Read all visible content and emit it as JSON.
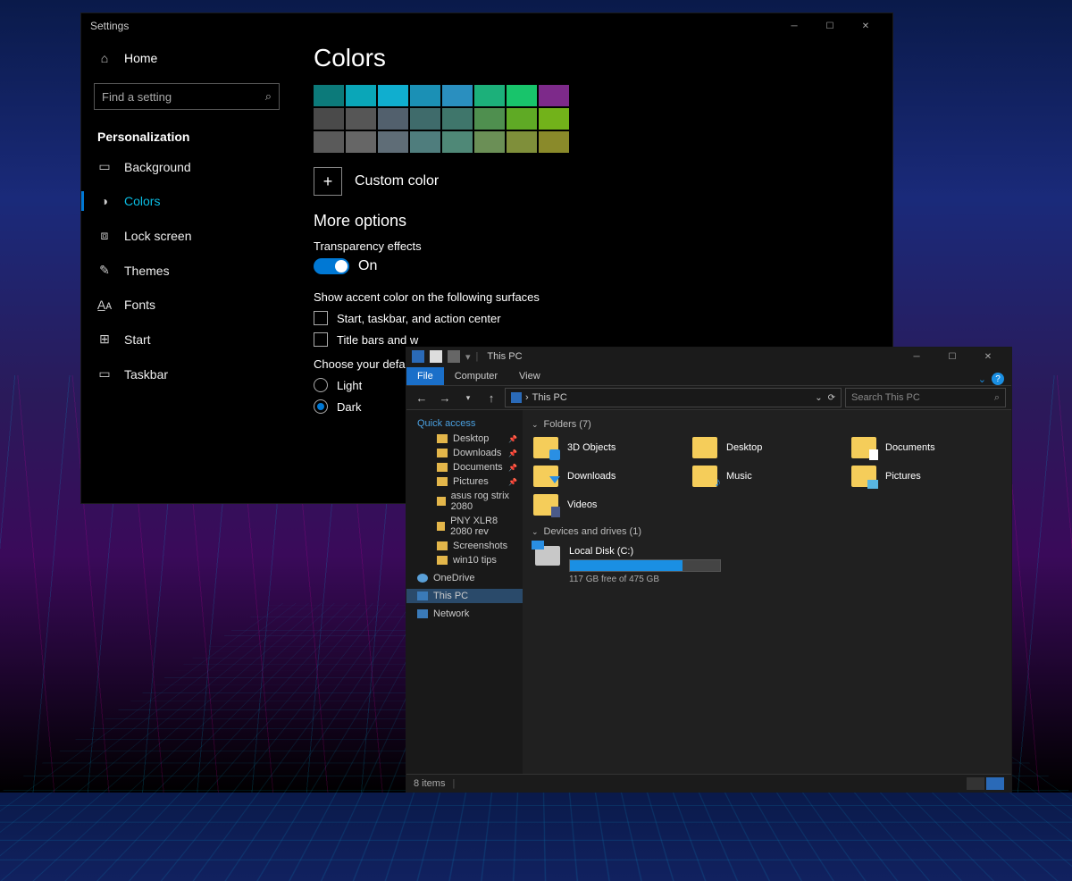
{
  "settings": {
    "window_title": "Settings",
    "home_label": "Home",
    "search_placeholder": "Find a setting",
    "section": "Personalization",
    "nav": [
      {
        "icon": "▭",
        "label": "Background"
      },
      {
        "icon": "◑",
        "label": "Colors",
        "active": true
      },
      {
        "icon": "⧈",
        "label": "Lock screen"
      },
      {
        "icon": "✎",
        "label": "Themes"
      },
      {
        "icon": "A̲ᴀ",
        "label": "Fonts"
      },
      {
        "icon": "⊞",
        "label": "Start"
      },
      {
        "icon": "▭",
        "label": "Taskbar"
      }
    ],
    "page_title": "Colors",
    "swatches_row1": [
      "#0c7a7a",
      "#0aa6b8",
      "#10aecf",
      "#1b90b5",
      "#2a8fbf",
      "#1cb07a",
      "#18c46b",
      "#7d2a8a"
    ],
    "swatches_row2": [
      "#4a4a4a",
      "#565656",
      "#52606d",
      "#3f6b6b",
      "#3f766b",
      "#4f8f4f",
      "#5faa25",
      "#72b21a"
    ],
    "swatches_row3": [
      "#5a5a5a",
      "#666666",
      "#5f6d77",
      "#4f7d7d",
      "#4f8877",
      "#6b8f56",
      "#7f8f3a",
      "#8a8a2a"
    ],
    "custom_color_label": "Custom color",
    "more_options_heading": "More options",
    "transparency_label": "Transparency effects",
    "transparency_state": "On",
    "accent_surfaces_label": "Show accent color on the following surfaces",
    "accent_cb1": "Start, taskbar, and action center",
    "accent_cb2": "Title bars and w",
    "choose_mode_label": "Choose your defaul",
    "mode_light": "Light",
    "mode_dark": "Dark"
  },
  "explorer": {
    "qat_title": "This PC",
    "tabs": {
      "file": "File",
      "computer": "Computer",
      "view": "View"
    },
    "addr_location": "This PC",
    "search_placeholder": "Search This PC",
    "tree": {
      "quick_access": "Quick access",
      "items": [
        {
          "label": "Desktop",
          "pin": true
        },
        {
          "label": "Downloads",
          "pin": true
        },
        {
          "label": "Documents",
          "pin": true
        },
        {
          "label": "Pictures",
          "pin": true
        },
        {
          "label": "asus rog strix 2080"
        },
        {
          "label": "PNY XLR8 2080 rev"
        },
        {
          "label": "Screenshots"
        },
        {
          "label": "win10 tips"
        }
      ],
      "onedrive": "OneDrive",
      "this_pc": "This PC",
      "network": "Network"
    },
    "groups": {
      "folders_header": "Folders (7)",
      "folders": [
        "3D Objects",
        "Desktop",
        "Documents",
        "Downloads",
        "Music",
        "Pictures",
        "Videos"
      ],
      "drives_header": "Devices and drives (1)",
      "drive_name": "Local Disk (C:)",
      "drive_free": "117 GB free of 475 GB",
      "drive_fill_pct": 75
    },
    "status_items": "8 items"
  }
}
